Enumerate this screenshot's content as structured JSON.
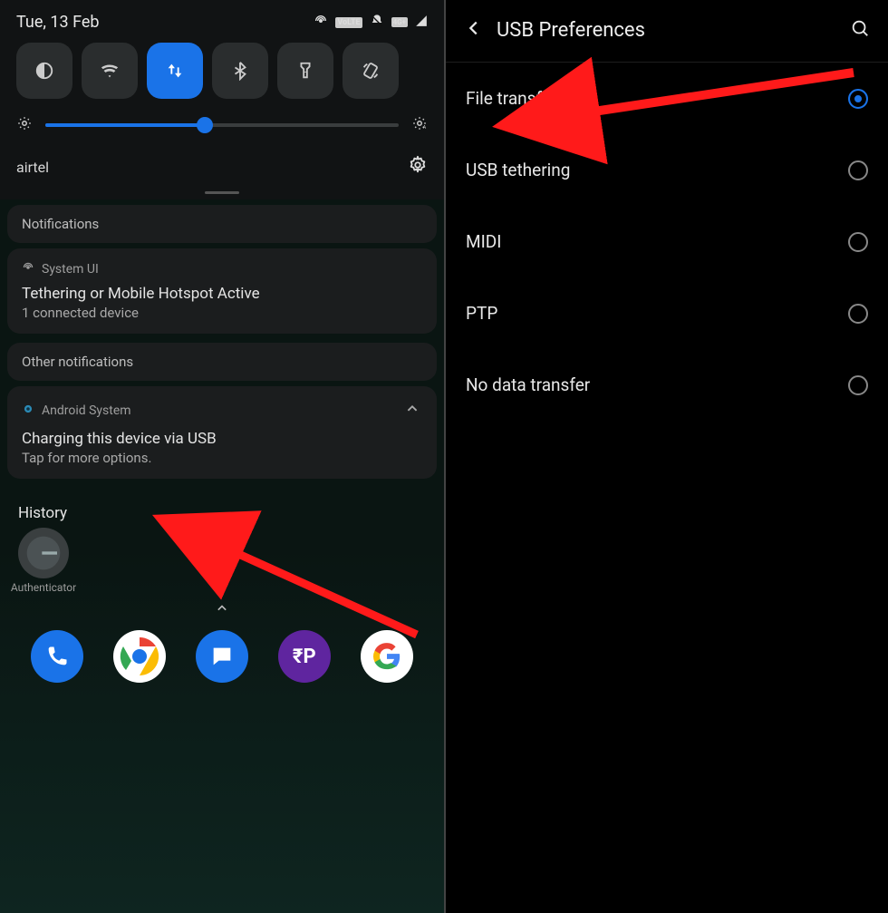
{
  "left": {
    "status": {
      "date": "Tue, 13 Feb",
      "volte_label": "VoLTE",
      "signal_label": "4G+"
    },
    "carrier": "airtel",
    "notif_sections": {
      "header1": "Notifications",
      "system_ui": {
        "app": "System UI",
        "title": "Tethering or Mobile Hotspot Active",
        "body": "1 connected device"
      },
      "header2": "Other notifications",
      "android_system": {
        "app": "Android System",
        "title": "Charging this device via USB",
        "body": "Tap for more options."
      }
    },
    "history_label": "History",
    "history_app": "Authenticator",
    "dock": {
      "phonepe": "₹P"
    }
  },
  "right": {
    "title": "USB Preferences",
    "options": [
      {
        "label": "File transfer",
        "selected": true
      },
      {
        "label": "USB tethering",
        "selected": false
      },
      {
        "label": "MIDI",
        "selected": false
      },
      {
        "label": "PTP",
        "selected": false
      },
      {
        "label": "No data transfer",
        "selected": false
      }
    ]
  }
}
